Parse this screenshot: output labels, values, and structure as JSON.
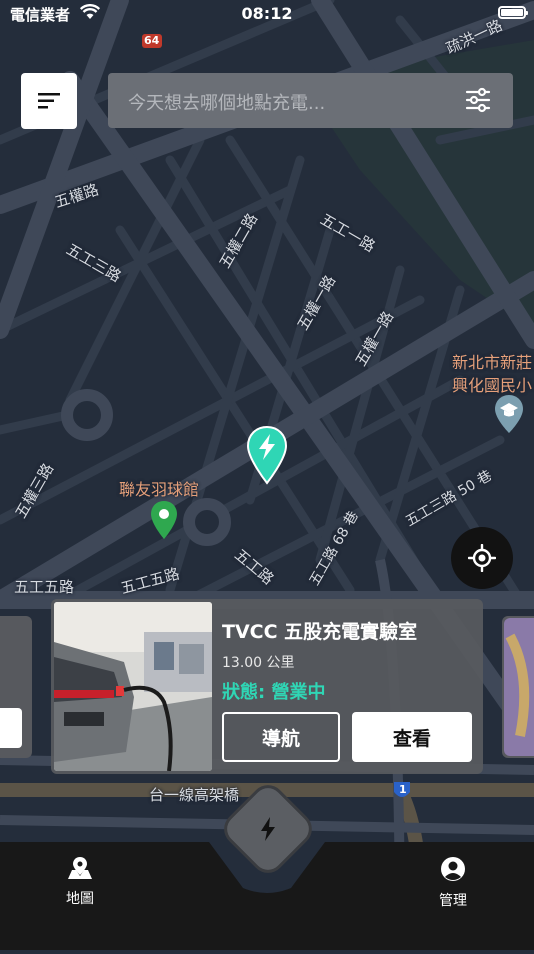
{
  "status_bar": {
    "carrier": "電信業者",
    "time": "08:12"
  },
  "search": {
    "placeholder": "今天想去哪個地點充電..."
  },
  "map": {
    "labels": {
      "wuquan_rd": "五權路",
      "wugong_3rd_a": "五工三路",
      "wuquan_2nd": "五權二路",
      "wugong_1st": "五工一路",
      "wuquan_1st_a": "五權一路",
      "wuquan_1st_b": "五權一路",
      "wuquan_3rd": "五權三路",
      "badminton": "聯友羽球館",
      "school_1": "新北市新莊",
      "school_2": "興化國民小",
      "wugong_3rd_lane": "五工三路 50 巷",
      "wugong_rd_lane": "五工路 68 巷",
      "wugong_rd": "五工路",
      "wugong_5th_a": "五工五路",
      "wugong_5th_b": "五工五路",
      "elevated": "台一線高架橋",
      "shuhong": "疏洪一路",
      "route_64": "64",
      "route_1": "1"
    }
  },
  "station_card": {
    "name": "TVCC 五股充電實驗室",
    "distance": "13.00 公里",
    "status": "狀態: 營業中",
    "navigate_label": "導航",
    "view_label": "查看"
  },
  "bottom_nav": {
    "map_label": "地圖",
    "manage_label": "管理"
  },
  "colors": {
    "map_bg": "#242d3b",
    "accent": "#2fd6b5",
    "card_bg": "#585a5f",
    "nav_bg": "#181818"
  },
  "icons": [
    "wifi-icon",
    "battery-icon",
    "menu-icon",
    "filter-icon",
    "charger-pin-icon",
    "green-pin-icon",
    "school-pin-icon",
    "locate-icon",
    "map-icon",
    "user-icon",
    "lightning-icon"
  ]
}
